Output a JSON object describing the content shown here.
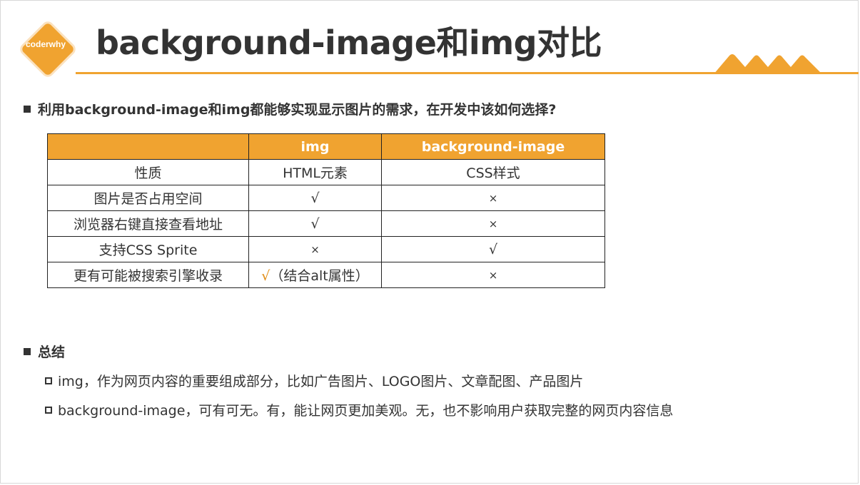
{
  "logo": {
    "text": "coderwhy"
  },
  "title": "background-image和img对比",
  "question": "利用background-image和img都能够实现显示图片的需求，在开发中该如何选择?",
  "table": {
    "headers": [
      "",
      "img",
      "background-image"
    ],
    "rows": [
      {
        "label": "性质",
        "img": "HTML元素",
        "bg": "CSS样式"
      },
      {
        "label": "图片是否占用空间",
        "img": "√",
        "bg": "×"
      },
      {
        "label": "浏览器右键直接查看地址",
        "img": "√",
        "bg": "×"
      },
      {
        "label": "支持CSS Sprite",
        "img": "×",
        "bg": "√"
      },
      {
        "label": "更有可能被搜索引擎收录",
        "img_mark": "√",
        "img": "（结合alt属性）",
        "bg": "×"
      }
    ]
  },
  "summary": {
    "heading": "总结",
    "items": [
      "img，作为网页内容的重要组成部分，比如广告图片、LOGO图片、文章配图、产品图片",
      "background-image，可有可无。有，能让网页更加美观。无，也不影响用户获取完整的网页内容信息"
    ]
  },
  "colors": {
    "accent": "#f0a330",
    "cross": "#e02020",
    "check": "#e08a10"
  }
}
